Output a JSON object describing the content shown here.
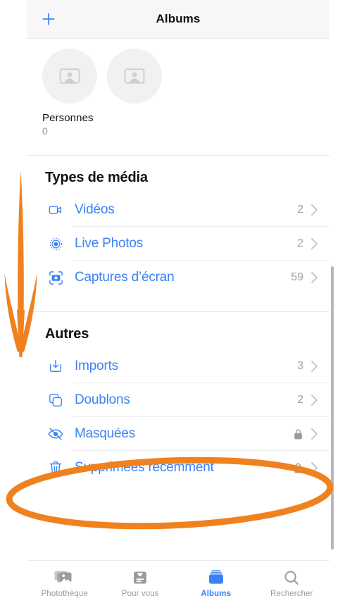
{
  "navbar": {
    "add_icon": "plus-icon",
    "title": "Albums"
  },
  "people": {
    "label": "Personnes",
    "count": "0",
    "placeholder_icon": "person-photo-placeholder-icon"
  },
  "sections": [
    {
      "title": "Types de média",
      "rows": [
        {
          "icon": "video-camera-icon",
          "label": "Vidéos",
          "count": "2",
          "locked": false,
          "chevron": "›"
        },
        {
          "icon": "live-photo-icon",
          "label": "Live Photos",
          "count": "2",
          "locked": false,
          "chevron": "›"
        },
        {
          "icon": "screenshot-camera-icon",
          "label": "Captures d’écran",
          "count": "59",
          "locked": false,
          "chevron": "›"
        }
      ]
    },
    {
      "title": "Autres",
      "rows": [
        {
          "icon": "import-download-icon",
          "label": "Imports",
          "count": "3",
          "locked": false,
          "chevron": "›"
        },
        {
          "icon": "duplicate-squares-icon",
          "label": "Doublons",
          "count": "2",
          "locked": false,
          "chevron": "›"
        },
        {
          "icon": "eye-slash-icon",
          "label": "Masquées",
          "count": "",
          "locked": true,
          "chevron": "›"
        },
        {
          "icon": "trash-icon",
          "label": "Supprimées récemment",
          "count": "",
          "locked": true,
          "chevron": "›"
        }
      ]
    }
  ],
  "tabbar": {
    "tabs": [
      {
        "icon": "photo-library-icon",
        "label": "Photothèque",
        "active": false
      },
      {
        "icon": "for-you-card-icon",
        "label": "Pour vous",
        "active": false
      },
      {
        "icon": "albums-stack-icon",
        "label": "Albums",
        "active": true
      },
      {
        "icon": "magnifier-icon",
        "label": "Rechercher",
        "active": false
      }
    ]
  },
  "annotations": {
    "color": "#f0811f",
    "arrow": {
      "name": "down-arrow-annotation"
    },
    "ellipse": {
      "name": "highlight-ellipse-annotation",
      "target": "Masquées"
    }
  },
  "colors": {
    "accent_blue": "#3b82f6",
    "annotation_orange": "#f0811f",
    "navbar_bg": "#f7f7f8",
    "secondary_text": "#9b9b9f"
  }
}
